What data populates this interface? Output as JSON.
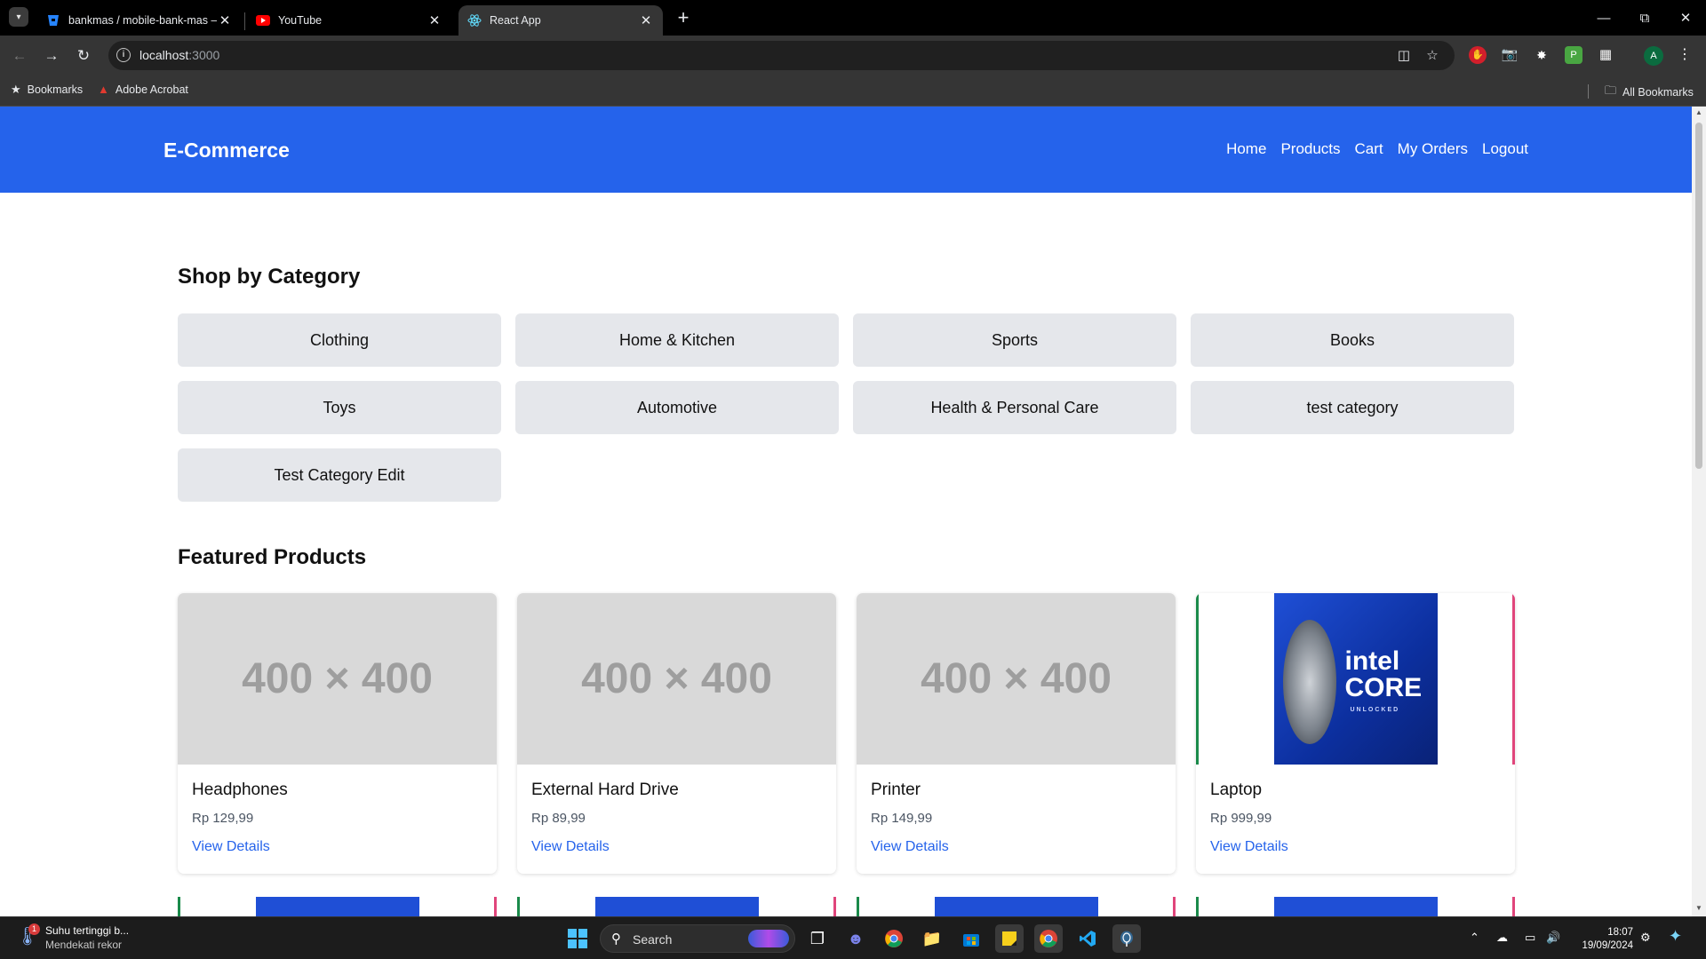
{
  "browser": {
    "tabs": [
      {
        "title": "bankmas / mobile-bank-mas —",
        "active": false
      },
      {
        "title": "YouTube",
        "active": false
      },
      {
        "title": "React App",
        "active": true
      }
    ],
    "url_host": "localhost",
    "url_port": ":3000",
    "bookmarks": [
      {
        "label": "Bookmarks"
      },
      {
        "label": "Adobe Acrobat"
      }
    ],
    "all_bookmarks": "All Bookmarks",
    "profile_initial": "A"
  },
  "app": {
    "brand": "E-Commerce",
    "nav": [
      "Home",
      "Products",
      "Cart",
      "My Orders",
      "Logout"
    ],
    "categories_title": "Shop by Category",
    "categories": [
      "Clothing",
      "Home & Kitchen",
      "Sports",
      "Books",
      "Toys",
      "Automotive",
      "Health & Personal Care",
      "test category",
      "Test Category Edit"
    ],
    "featured_title": "Featured Products",
    "products": [
      {
        "name": "Headphones",
        "price": "Rp 129,99",
        "image_placeholder": "400 × 400",
        "link": "View Details"
      },
      {
        "name": "External Hard Drive",
        "price": "Rp 89,99",
        "image_placeholder": "400 × 400",
        "link": "View Details"
      },
      {
        "name": "Printer",
        "price": "Rp 149,99",
        "image_placeholder": "400 × 400",
        "link": "View Details"
      },
      {
        "name": "Laptop",
        "price": "Rp 999,99",
        "image_text": "intel CORE",
        "image_subtext": "UNLOCKED",
        "link": "View Details"
      }
    ]
  },
  "taskbar": {
    "weather_title": "Suhu tertinggi b...",
    "weather_sub": "Mendekati rekor",
    "weather_badge": "1",
    "search_label": "Search",
    "time": "18:07",
    "date": "19/09/2024"
  },
  "colors": {
    "accent": "#2563eb",
    "category_bg": "#e5e7eb"
  }
}
